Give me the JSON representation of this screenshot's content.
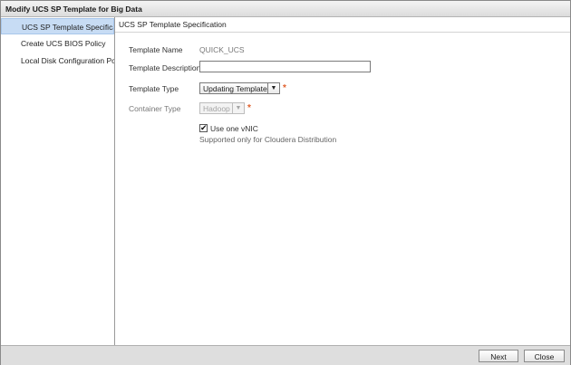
{
  "window": {
    "title": "Modify UCS SP Template for Big Data"
  },
  "nav": {
    "items": [
      {
        "label": "UCS SP Template Specification",
        "active": true
      },
      {
        "label": "Create UCS BIOS Policy",
        "active": false
      },
      {
        "label": "Local Disk Configuration Policy",
        "active": false
      }
    ]
  },
  "section": {
    "title": "UCS SP Template Specification"
  },
  "form": {
    "template_name": {
      "label": "Template Name",
      "value": "QUICK_UCS"
    },
    "template_description": {
      "label": "Template Description",
      "value": ""
    },
    "template_type": {
      "label": "Template Type",
      "selected": "Updating Template"
    },
    "container_type": {
      "label": "Container Type",
      "selected": "Hadoop"
    },
    "required_marker": "*",
    "use_one_vnic": {
      "label": "Use one vNIC",
      "checked": true
    },
    "note": "Supported only for Cloudera Distribution"
  },
  "icons": {
    "dropdown": "chevron-down-icon",
    "check": "checkmark-icon",
    "scroll_left": "arrow-left-icon",
    "scroll_right": "arrow-right-icon"
  },
  "footer": {
    "next_label": "Next",
    "close_label": "Close"
  },
  "colors": {
    "accent_selected": "#c7dcf4",
    "required": "#e0602c"
  }
}
